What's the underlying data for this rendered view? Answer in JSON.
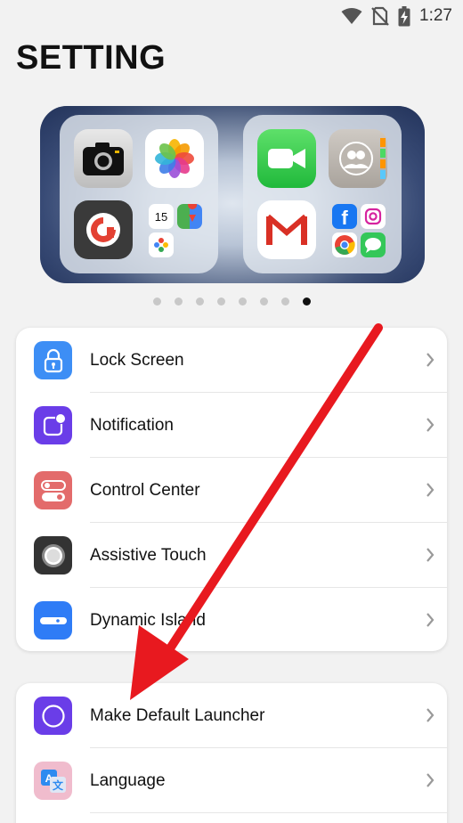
{
  "status_bar": {
    "time": "1:27",
    "icons": [
      "wifi-icon",
      "no-sim-icon",
      "battery-charging-icon"
    ]
  },
  "page": {
    "title": "SETTING"
  },
  "carousel": {
    "page_count": 8,
    "active_index": 7
  },
  "settings_group_1": [
    {
      "label": "Lock Screen",
      "icon": "lock-icon",
      "color": "#3d8ef5"
    },
    {
      "label": "Notification",
      "icon": "notification-icon",
      "color": "#6a3de8"
    },
    {
      "label": "Control Center",
      "icon": "toggle-icon",
      "color": "#e36b6b"
    },
    {
      "label": "Assistive Touch",
      "icon": "assistive-touch-icon",
      "color": "#333333"
    },
    {
      "label": "Dynamic Island",
      "icon": "dynamic-island-icon",
      "color": "#2f7cf6"
    }
  ],
  "settings_group_2": [
    {
      "label": "Make Default Launcher",
      "icon": "circle-icon",
      "color": "#6a3de8"
    },
    {
      "label": "Language",
      "icon": "translate-icon",
      "color": "#f0bccd"
    }
  ],
  "annotation": {
    "type": "arrow",
    "color": "#e8191f"
  }
}
